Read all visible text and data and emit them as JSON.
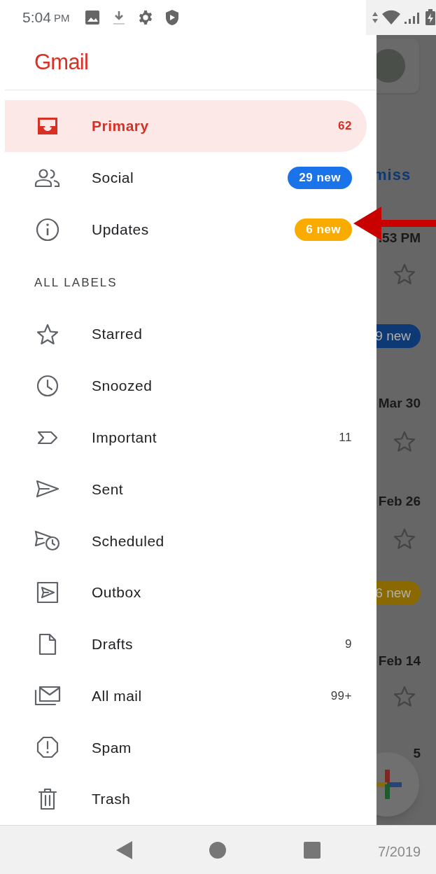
{
  "status_bar": {
    "time": "5:04",
    "period": "PM"
  },
  "drawer": {
    "title": "Gmail",
    "inbox_items": [
      {
        "kind": "count",
        "label": "Primary",
        "count": "62",
        "selected": true
      },
      {
        "kind": "badge",
        "label": "Social",
        "count": "29 new",
        "color": "#1a73e8",
        "selected": false
      },
      {
        "kind": "badge",
        "label": "Updates",
        "count": "6 new",
        "color": "#f9ab00",
        "selected": false
      }
    ],
    "section_heading": "ALL LABELS",
    "label_items": [
      {
        "kind": "star",
        "label": "Starred",
        "selected": false
      },
      {
        "kind": "clock",
        "label": "Snoozed",
        "selected": false
      },
      {
        "kind": "important",
        "label": "Important",
        "count": "11",
        "selected": false
      },
      {
        "kind": "sent",
        "label": "Sent",
        "selected": false
      },
      {
        "kind": "scheduled",
        "label": "Scheduled",
        "selected": false
      },
      {
        "kind": "outbox",
        "label": "Outbox",
        "selected": false
      },
      {
        "kind": "draft",
        "label": "Drafts",
        "count": "9",
        "selected": false
      },
      {
        "kind": "allmail",
        "label": "All mail",
        "count": "99+",
        "selected": false
      },
      {
        "kind": "spam",
        "label": "Spam",
        "selected": false
      },
      {
        "kind": "trash",
        "label": "Trash",
        "selected": false
      }
    ]
  },
  "background": {
    "items": [
      {
        "kind": "link",
        "text": "miss"
      },
      {
        "kind": "time",
        "text": ".53 PM"
      },
      {
        "kind": "star"
      },
      {
        "kind": "badge",
        "text": "9 new",
        "color": "#0d3a74"
      },
      {
        "kind": "time",
        "text": "Mar 30"
      },
      {
        "kind": "star"
      },
      {
        "kind": "time",
        "text": "Feb 26"
      },
      {
        "kind": "star"
      },
      {
        "kind": "badge",
        "text": "6 new",
        "color": "#8a6a00"
      },
      {
        "kind": "time",
        "text": "Feb 14"
      },
      {
        "kind": "star"
      },
      {
        "kind": "time",
        "text": "5"
      },
      {
        "kind": "footer",
        "text": "7/2019"
      }
    ]
  }
}
